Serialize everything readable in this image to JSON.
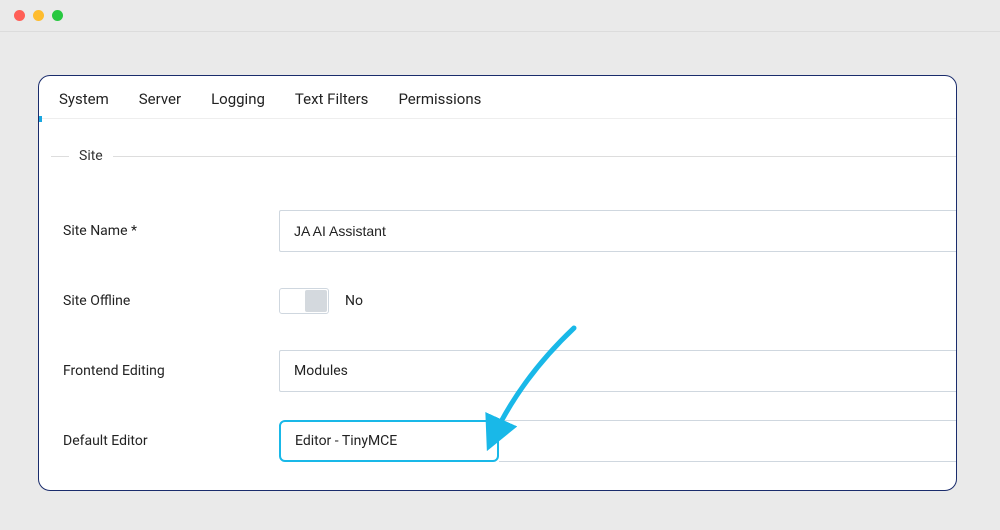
{
  "tabs": {
    "system": "System",
    "server": "Server",
    "logging": "Logging",
    "text_filters": "Text Filters",
    "permissions": "Permissions"
  },
  "fieldset_label": "Site",
  "fields": {
    "site_name": {
      "label": "Site Name *",
      "value": "JA AI Assistant"
    },
    "site_offline": {
      "label": "Site Offline",
      "value": "No"
    },
    "frontend_editing": {
      "label": "Frontend Editing",
      "value": "Modules"
    },
    "default_editor": {
      "label": "Default Editor",
      "value": "Editor - TinyMCE"
    }
  }
}
